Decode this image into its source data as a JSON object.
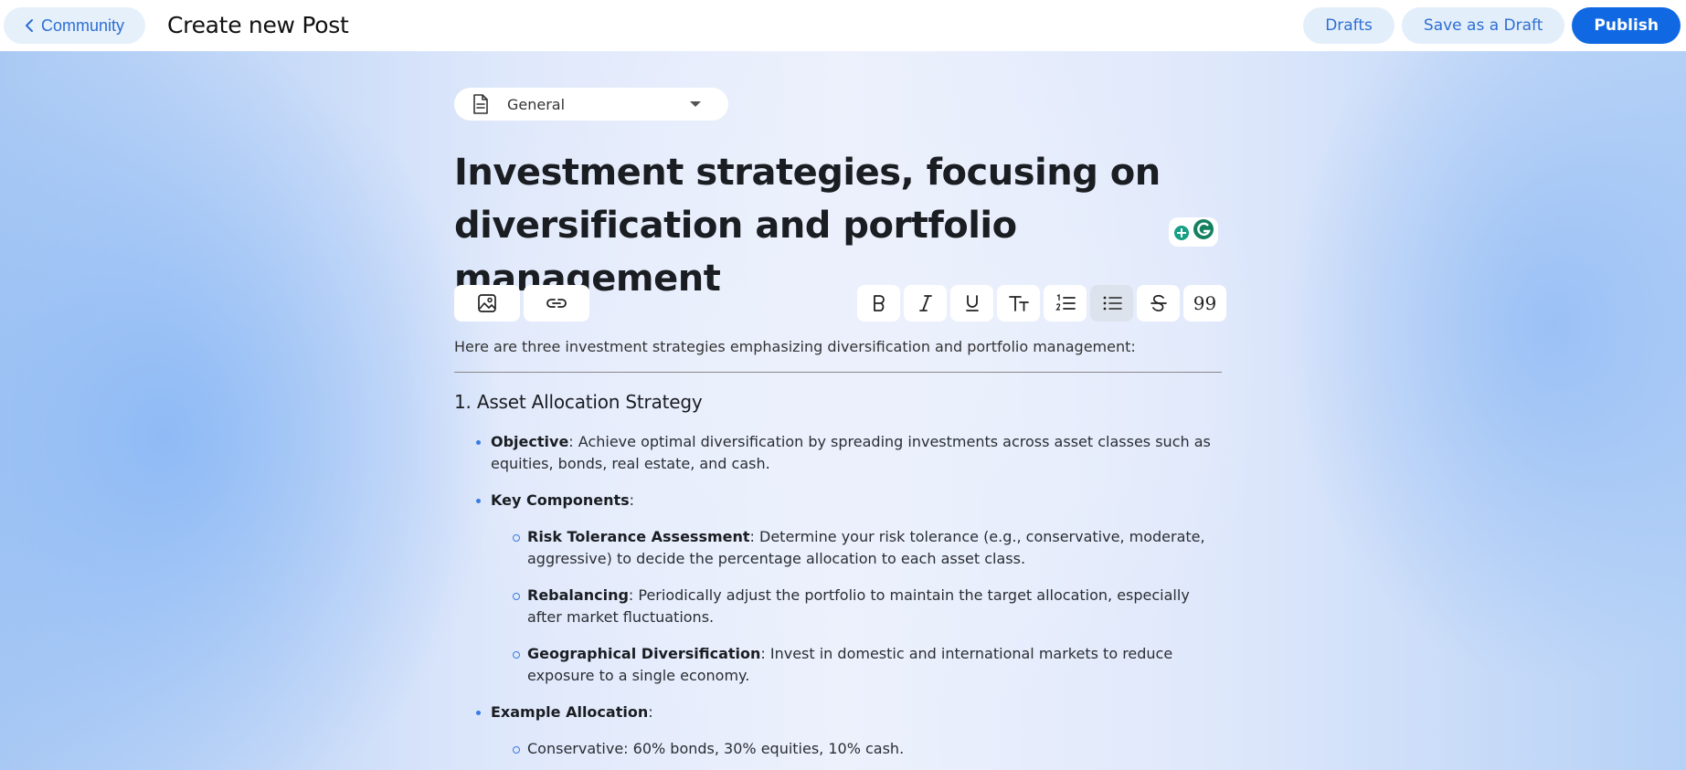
{
  "header": {
    "back_label": "Community",
    "title": "Create new Post",
    "drafts_label": "Drafts",
    "save_draft_label": "Save as a Draft",
    "publish_label": "Publish"
  },
  "category": {
    "selected": "General"
  },
  "post": {
    "title": " Investment strategies, focusing on diversification and portfolio management"
  },
  "toolbar": {
    "italic_glyph": "I",
    "underline_glyph": "U",
    "quote_glyph": "99"
  },
  "body": {
    "intro": "Here are three investment strategies emphasizing diversification and portfolio management:",
    "section1_heading": "1. Asset Allocation Strategy",
    "objective_term": "Objective",
    "objective_text": ": Achieve optimal diversification by spreading investments across asset classes such as equities, bonds, real estate, and cash.",
    "key_components_term": "Key Components",
    "key_components_text": ":",
    "components": [
      {
        "term": "Risk Tolerance Assessment",
        "text": ": Determine your risk tolerance (e.g., conservative, moderate, aggressive) to decide the percentage allocation to each asset class."
      },
      {
        "term": "Rebalancing",
        "text": ": Periodically adjust the portfolio to maintain the target allocation, especially after market fluctuations."
      },
      {
        "term": "Geographical Diversification",
        "text": ": Invest in domestic and international markets to reduce exposure to a single economy."
      }
    ],
    "example_term": "Example Allocation",
    "example_text": ":",
    "example_items": [
      "Conservative: 60% bonds, 30% equities, 10% cash."
    ]
  },
  "colors": {
    "accent": "#1068e3",
    "accent_light": "#e3eefb"
  }
}
